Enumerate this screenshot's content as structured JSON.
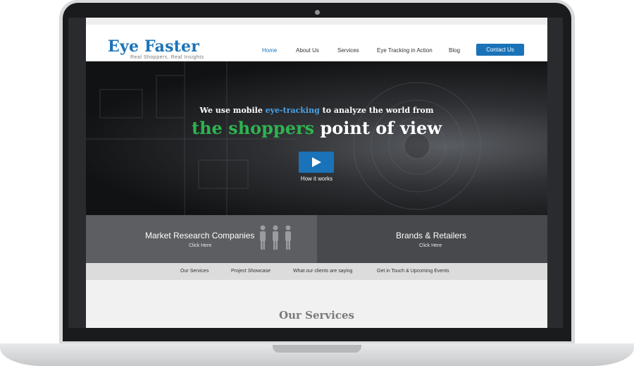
{
  "brand": {
    "title": "Eye Faster",
    "tagline": "Real Shoppers, Real Insights",
    "accent_color": "#1a73b8",
    "highlight_green": "#2fb34f"
  },
  "nav": {
    "items": [
      "Home",
      "About Us",
      "Services",
      "Eye Tracking in Action",
      "Blog"
    ],
    "active": "Home",
    "contact_label": "Contact Us"
  },
  "hero": {
    "line1_pre": "We use mobile ",
    "line1_highlight": "eye-tracking",
    "line1_post": " to analyze the world from",
    "line2_green": "the shoppers",
    "line2_rest": " point of view",
    "play_icon": "play-icon",
    "how_label": "How it works"
  },
  "audience": {
    "left_title": "Market Research Companies",
    "left_click": "Click Here",
    "left_icon": "people-icon",
    "right_title": "Brands & Retailers",
    "right_click": "Click Here"
  },
  "subnav": {
    "items": [
      "Our Services",
      "Project Showcase",
      "What our clients are saying",
      "Get in Touch & Upcoming Events"
    ]
  },
  "services": {
    "title": "Our Services"
  }
}
